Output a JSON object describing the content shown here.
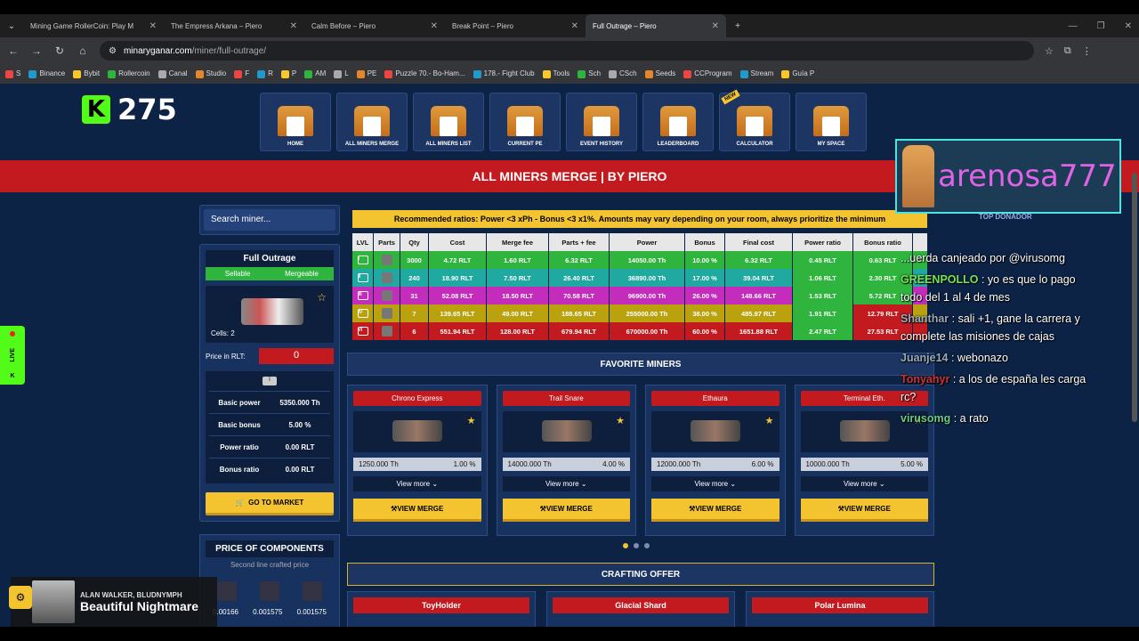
{
  "browser": {
    "tabs": [
      {
        "title": "Mining Game RollerCoin: Play M",
        "active": false
      },
      {
        "title": "The Empress Arkana – Piero",
        "active": false
      },
      {
        "title": "Calm Before – Piero",
        "active": false
      },
      {
        "title": "Break Point – Piero",
        "active": false
      },
      {
        "title": "Full Outrage – Piero",
        "active": true
      }
    ],
    "new_tab": "+",
    "url_domain": "minaryganar.com",
    "url_path": "/miner/full-outrage/",
    "bookmarks": [
      "S",
      "Binance",
      "Bybit",
      "Rollercoin",
      "Canal",
      "Studio",
      "F",
      "R",
      "P",
      "AM",
      "L",
      "PE",
      "Puzzle 70.- Bo-Ham...",
      "178.- Fight Club",
      "Tools",
      "Sch",
      "CSch",
      "Seeds",
      "CCProgram",
      "Stream",
      "Guía P"
    ]
  },
  "header": {
    "counter": "275",
    "menu": [
      {
        "label": "HOME",
        "new": false
      },
      {
        "label": "ALL MINERS MERGE",
        "new": false
      },
      {
        "label": "ALL MINERS LIST",
        "new": false
      },
      {
        "label": "CURRENT PE",
        "new": false
      },
      {
        "label": "EVENT HISTORY",
        "new": false
      },
      {
        "label": "LEADERBOARD",
        "new": false
      },
      {
        "label": "CALCULATOR",
        "new": true
      },
      {
        "label": "MY SPACE",
        "new": false
      }
    ],
    "new_badge": "NEW",
    "banner": "ALL MINERS MERGE | BY PIERO"
  },
  "left": {
    "search_placeholder": "Search miner...",
    "miner_name": "Full Outrage",
    "tag_sellable": "Sellable",
    "tag_mergeable": "Mergeable",
    "cells": "Cells: 2",
    "price_label": "Price in RLT:",
    "price_value": "0",
    "stats": [
      {
        "label": "Basic power",
        "value": "5350.000 Th"
      },
      {
        "label": "Basic bonus",
        "value": "5.00 %"
      },
      {
        "label": "Power ratio",
        "value": "0.00 RLT"
      },
      {
        "label": "Bonus ratio",
        "value": "0.00 RLT"
      }
    ],
    "market_button": "GO TO MARKET",
    "components_title": "PRICE OF COMPONENTS",
    "components_sub": "Second line crafted price",
    "component_values": [
      "0.00166",
      "0.001575",
      "0.001575"
    ]
  },
  "main": {
    "recommend": "Recommended ratios: Power <3 xPh - Bonus <3 x1%. Amounts may vary depending on your room, always prioritize the minimum",
    "table_headers": [
      "LVL",
      "Parts",
      "Qty",
      "Cost",
      "Merge fee",
      "Parts + fee",
      "Power",
      "Bonus",
      "Final cost",
      "Power ratio",
      "Bonus ratio"
    ],
    "rows": [
      {
        "color": "#2fb53e",
        "lv": "I",
        "qty": "3000",
        "cost": "4.72 RLT",
        "fee": "1.60 RLT",
        "pf": "6.32 RLT",
        "power": "14050.00 Th",
        "bonus": "10.00 %",
        "final": "6.32 RLT",
        "pr": "0.45 RLT",
        "br": "0.63 RLT",
        "br_color": "#2fb53e"
      },
      {
        "color": "#1fa9a0",
        "lv": "II",
        "qty": "240",
        "cost": "18.90 RLT",
        "fee": "7.50 RLT",
        "pf": "26.40 RLT",
        "power": "36890.00 Th",
        "bonus": "17.00 %",
        "final": "39.04 RLT",
        "pr": "1.06 RLT",
        "br": "2.30 RLT",
        "br_color": "#2fb53e"
      },
      {
        "color": "#c42dbb",
        "lv": "III",
        "qty": "31",
        "cost": "52.08 RLT",
        "fee": "18.50 RLT",
        "pf": "70.58 RLT",
        "power": "96900.00 Th",
        "bonus": "26.00 %",
        "final": "148.66 RLT",
        "pr": "1.53 RLT",
        "br": "5.72 RLT",
        "br_color": "#2fb53e"
      },
      {
        "color": "#b9a20e",
        "lv": "IV",
        "qty": "7",
        "cost": "139.65 RLT",
        "fee": "49.00 RLT",
        "pf": "188.65 RLT",
        "power": "255000.00 Th",
        "bonus": "38.00 %",
        "final": "485.97 RLT",
        "pr": "1.91 RLT",
        "br": "12.79 RLT",
        "br_color": "#c21a1f"
      },
      {
        "color": "#c21a1f",
        "lv": "VI",
        "qty": "6",
        "cost": "551.94 RLT",
        "fee": "128.00 RLT",
        "pf": "679.94 RLT",
        "power": "670000.00 Th",
        "bonus": "60.00 %",
        "final": "1651.88 RLT",
        "pr": "2.47 RLT",
        "br": "27.53 RLT",
        "br_color": "#c21a1f"
      }
    ],
    "favorites_title": "FAVORITE MINERS",
    "favorites": [
      {
        "name": "Chrono Express",
        "power": "1250.000 Th",
        "bonus": "1.00 %"
      },
      {
        "name": "Trail Snare",
        "power": "14000.000 Th",
        "bonus": "4.00 %"
      },
      {
        "name": "Ethaura",
        "power": "12000.000 Th",
        "bonus": "6.00 %"
      },
      {
        "name": "Terminal Eth.",
        "power": "10000.000 Th",
        "bonus": "5.00 %"
      }
    ],
    "view_more": "View more",
    "view_merge": "VIEW MERGE",
    "crafting_title": "CRAFTING OFFER",
    "crafting": [
      "ToyHolder",
      "Glacial Shard",
      "Polar Lumina"
    ]
  },
  "stream": {
    "donor_name": "arenosa777",
    "donor_label": "TOP DONADOR",
    "chat": [
      {
        "user": "",
        "text": "...uerda canjeado por @virusomg",
        "cls": "u3"
      },
      {
        "user": "GREENPOLLO",
        "text": " : yo es que lo pago todo del 1 al 4 de mes",
        "cls": "u2"
      },
      {
        "user": "Shanthar",
        "text": " : sali +1, gane la carrera y complete las misiones de cajas",
        "cls": "u3"
      },
      {
        "user": "Juanje14",
        "text": " : webonazo",
        "cls": "u3"
      },
      {
        "user": "Tonyahyr",
        "text": " : a los de españa les carga rc?",
        "cls": "u4"
      },
      {
        "user": "virusomg",
        "text": " : a rato",
        "cls": "u5"
      }
    ],
    "live_label": "LIVE",
    "now_playing_artist": "ALAN WALKER, BLUDNYMPH",
    "now_playing_song": "Beautiful Nightmare"
  }
}
